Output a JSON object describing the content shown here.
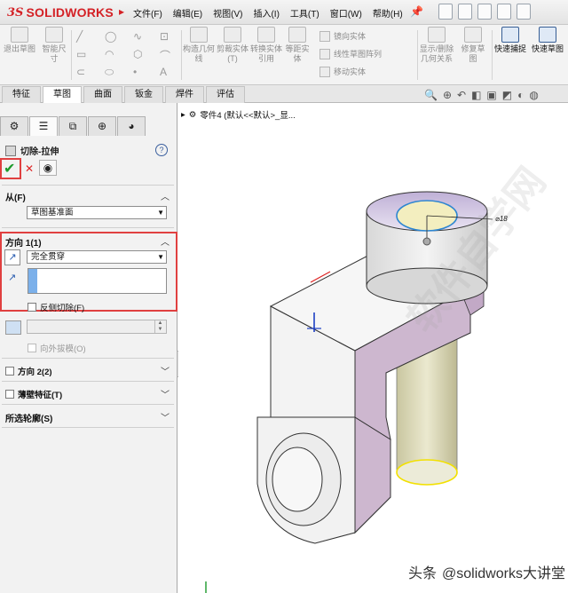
{
  "app": {
    "logo_ds": "3S",
    "logo_text": "SOLIDWORKS",
    "menu": [
      "文件(F)",
      "编辑(E)",
      "视图(V)",
      "插入(I)",
      "工具(T)",
      "窗口(W)",
      "帮助(H)"
    ]
  },
  "ribbon": {
    "buttons": [
      {
        "label": "退出草图",
        "icon": "exit-sketch-icon"
      },
      {
        "label": "智能尺寸",
        "icon": "smart-dimension-icon"
      },
      {
        "label": "构造几何线",
        "icon": "construction-icon"
      },
      {
        "label": "剪裁实体(T)",
        "icon": "trim-icon"
      },
      {
        "label": "转换实体引用",
        "icon": "convert-entities-icon"
      },
      {
        "label": "等距实体",
        "icon": "offset-icon"
      },
      {
        "label": "显示/删除几何关系",
        "icon": "relations-icon"
      },
      {
        "label": "修复草图",
        "icon": "repair-sketch-icon"
      },
      {
        "label": "快速捕捉",
        "icon": "quick-snap-icon"
      },
      {
        "label": "快速草图",
        "icon": "rapid-sketch-icon"
      }
    ],
    "list_items": [
      "镜向实体",
      "线性草图阵列",
      "移动实体"
    ]
  },
  "tabs": [
    "特征",
    "草图",
    "曲面",
    "钣金",
    "焊件",
    "评估"
  ],
  "active_tab": "草图",
  "tree": {
    "part_label": "零件4  (默认<<默认>_显..."
  },
  "panel": {
    "tabs": [
      "feature-manager-icon",
      "property-manager-icon",
      "configuration-manager-icon",
      "dimxpert-icon",
      "display-manager-icon"
    ],
    "feature_title": "切除-拉伸",
    "from_label": "从(F)",
    "from_value": "草图基准面",
    "direction1_label": "方向 1(1)",
    "end_condition": "完全贯穿",
    "flip_side_label": "反侧切除(F)",
    "draft_outward_label": "向外拔模(O)",
    "direction2_label": "方向 2(2)",
    "thin_feature_label": "薄壁特征(T)",
    "selected_contours_label": "所选轮廓(S)"
  },
  "viewport": {
    "dimension_label": "⌀18",
    "watermark": "软件自学网"
  },
  "credit": {
    "source": "头条",
    "handle": "@solidworks大讲堂"
  },
  "colors": {
    "brand_red": "#d42126",
    "highlight_red": "#e04040",
    "ok_green": "#1b9a2b",
    "selection_blue": "#7bb0ea",
    "part_gray": "#e8e8e8",
    "part_purple": "#cdb7cf",
    "sketch_yellow": "#f2e000"
  }
}
